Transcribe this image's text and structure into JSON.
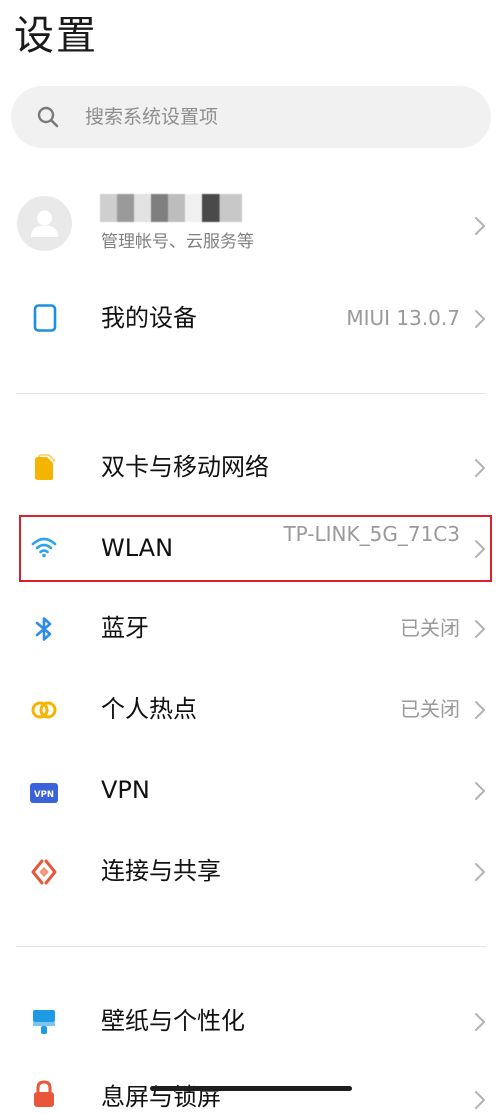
{
  "header": {
    "title": "设置"
  },
  "search": {
    "placeholder": "搜索系统设置项"
  },
  "account": {
    "subtitle": "管理帐号、云服务等"
  },
  "my_device": {
    "label": "我的设备",
    "value": "MIUI 13.0.7"
  },
  "network": {
    "dual_sim": {
      "label": "双卡与移动网络"
    },
    "wlan": {
      "label": "WLAN",
      "value": "TP-LINK_5G_71C3"
    },
    "bluetooth": {
      "label": "蓝牙",
      "value": "已关闭"
    },
    "hotspot": {
      "label": "个人热点",
      "value": "已关闭"
    },
    "vpn": {
      "label": "VPN",
      "badge": "VPN"
    },
    "connection_sharing": {
      "label": "连接与共享"
    }
  },
  "personal": {
    "wallpaper": {
      "label": "壁纸与个性化"
    },
    "lock_screen": {
      "label": "息屏与锁屏"
    }
  },
  "colors": {
    "highlight_border": "#d7222d",
    "device_icon": "#1b8fe0",
    "sim_icon": "#f5b400",
    "wlan_icon": "#2fa3e8",
    "bluetooth_icon": "#2e8be6",
    "hotspot_icon": "#f5b400",
    "vpn_icon": "#3b63d9",
    "share_icon": "#e8573a",
    "wallpaper_icon": "#1f9be6",
    "lock_icon": "#e8573a"
  },
  "icons": {
    "search": "magnifier-icon",
    "avatar": "person-icon",
    "device": "phone-icon",
    "sim": "sim-card-icon",
    "wlan": "wifi-icon",
    "bluetooth": "bluetooth-icon",
    "hotspot": "hotspot-rings-icon",
    "vpn": "vpn-badge-icon",
    "share": "connection-share-icon",
    "wallpaper": "brush-icon",
    "lock": "lock-icon",
    "chevron": "chevron-right-icon"
  }
}
